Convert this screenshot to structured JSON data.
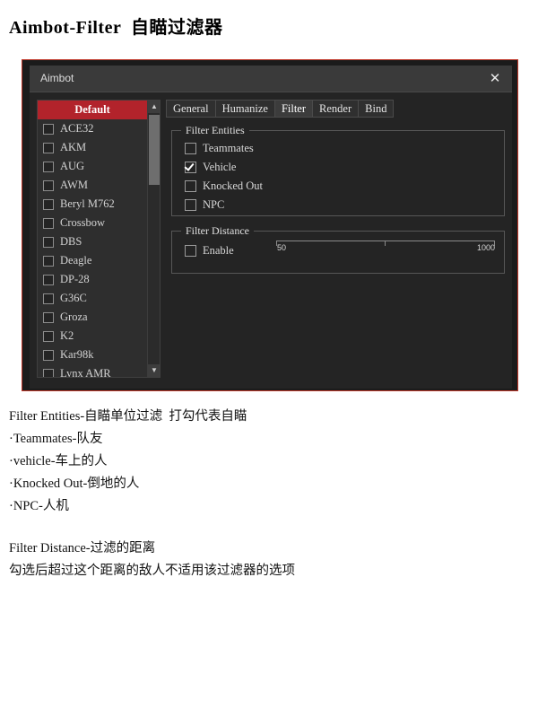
{
  "page": {
    "title": "Aimbot-Filter  自瞄过滤器"
  },
  "window": {
    "title": "Aimbot",
    "close_label": "✕"
  },
  "weapon_list": {
    "selected": "Default",
    "items": [
      "ACE32",
      "AKM",
      "AUG",
      "AWM",
      "Beryl M762",
      "Crossbow",
      "DBS",
      "Deagle",
      "DP-28",
      "G36C",
      "Groza",
      "K2",
      "Kar98k",
      "Lynx AMR"
    ],
    "scroll_up": "▲",
    "scroll_down": "▼"
  },
  "tabs": [
    {
      "label": "General",
      "active": false
    },
    {
      "label": "Humanize",
      "active": false
    },
    {
      "label": "Filter",
      "active": true
    },
    {
      "label": "Render",
      "active": false
    },
    {
      "label": "Bind",
      "active": false
    }
  ],
  "filter_entities": {
    "title": "Filter Entities",
    "options": [
      {
        "label": "Teammates",
        "checked": false
      },
      {
        "label": "Vehicle",
        "checked": true
      },
      {
        "label": "Knocked Out",
        "checked": false
      },
      {
        "label": "NPC",
        "checked": false
      }
    ]
  },
  "filter_distance": {
    "title": "Filter Distance",
    "enable": {
      "label": "Enable",
      "checked": false
    },
    "slider": {
      "min": "50",
      "max": "1000"
    }
  },
  "notes": [
    "Filter Entities-自瞄单位过滤  打勾代表自瞄",
    "·Teammates-队友",
    "·vehicle-车上的人",
    "·Knocked Out-倒地的人",
    "·NPC-人机",
    "",
    "Filter Distance-过滤的距离",
    "勾选后超过这个距离的敌人不适用该过滤器的选项"
  ],
  "colors": {
    "accent": "#b2232b",
    "frame": "#c0392b",
    "window_bg": "#242424"
  }
}
